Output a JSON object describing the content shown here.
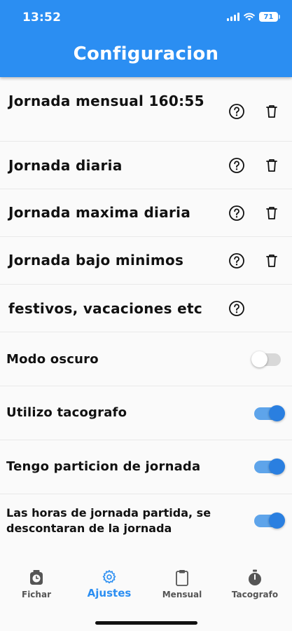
{
  "status_bar": {
    "time": "13:52",
    "battery": "71"
  },
  "header": {
    "title": "Configuracion"
  },
  "settings": [
    {
      "label": "Jornada mensual 160:55",
      "icons": [
        "help-icon",
        "trash-icon"
      ]
    },
    {
      "label": "Jornada diaria",
      "icons": [
        "help-icon",
        "trash-icon"
      ]
    },
    {
      "label": "Jornada maxima diaria",
      "icons": [
        "help-icon",
        "trash-icon"
      ]
    },
    {
      "label": "Jornada bajo minimos",
      "icons": [
        "help-icon",
        "trash-icon"
      ]
    },
    {
      "label": "festivos, vacaciones etc",
      "icons": [
        "help-icon"
      ]
    }
  ],
  "toggles": [
    {
      "label": "Modo oscuro",
      "on": false
    },
    {
      "label": "Utilizo tacografo",
      "on": true
    },
    {
      "label": "Tengo particion de jornada",
      "on": true
    },
    {
      "label": "Las horas de jornada partida, se descontaran de la jornada",
      "on": true
    }
  ],
  "tabs": [
    {
      "label": "Fichar",
      "icon": "clock-lock-icon",
      "active": false
    },
    {
      "label": "Ajustes",
      "icon": "gear-icon",
      "active": true
    },
    {
      "label": "Mensual",
      "icon": "clipboard-icon",
      "active": false
    },
    {
      "label": "Tacografo",
      "icon": "stopwatch-icon",
      "active": false
    }
  ],
  "colors": {
    "accent": "#2b8ef2",
    "toggle_on_track": "#5ea4ea",
    "toggle_on_knob": "#2a7fe0",
    "toggle_off_track": "#d8d8d8"
  }
}
